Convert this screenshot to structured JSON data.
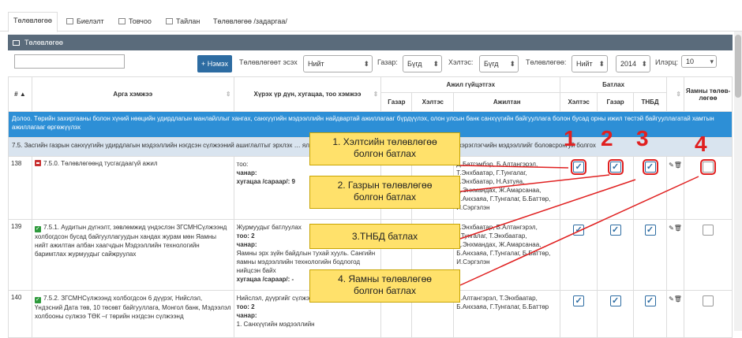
{
  "tabs": [
    {
      "label": "Төлөвлөгөө"
    },
    {
      "label": "Биелэлт"
    },
    {
      "label": "Товчоо"
    },
    {
      "label": "Тайлан"
    },
    {
      "label": "Төлөвлөгөө /задаргаа/"
    }
  ],
  "panel_title": "Төлөвлөгөө",
  "toolbar": {
    "add_label": "+ Нэмэх",
    "filter1_label": "Төлөвлөгөөт эсэх",
    "filter1_value": "Нийт",
    "filter2_label": "Газар:",
    "filter2_value": "Бүгд",
    "filter3_label": "Хэлтэс:",
    "filter3_value": "Бүгд",
    "filter4_label": "Төлөвлөгөө:",
    "filter4_value": "Нийт",
    "year_value": "2014",
    "filter5_label": "Илэрц:",
    "page_size": "10"
  },
  "headers": {
    "num": "#",
    "activity": "Арга хэмжээ",
    "result": "Хүрэх үр дүн, хугацаа, тоо хэмжээ",
    "work_perf": "Ажил гүйцэтгэх",
    "dept": "Газар",
    "unit": "Хэлтэс",
    "staff": "Ажилтан",
    "approve": "Батлах",
    "a_unit": "Хэлтэс",
    "a_dept": "Газар",
    "a_tnbd": "ТНБД",
    "ministry": "Яамны төлөв-лөгөө"
  },
  "group_row_1": "Долоо. Төрийн захиргааны болон хүний нөөцийн удирдлагын манлайллыг хангах, санхүүгийн мэдээллийн найдвартай ажиллагааг бүрдүүлэх, олон улсын банк санхүүгийн байгууллага болон бусад орны ижил төстэй байгууллагатай хамтын ажиллагааг өргөжүүлэх",
  "group_row_2": "7.5. Засгийн газрын санхүүгийн удирдлагын мэдээллийн нэгдсэн сүлжээний ашиглалтыг эрхлэх … ялгаагүйгээр санхүүгийн мэдээллийн сан бүрдүүлэх, хэрэглэгчийн мэдээллийг боловсронгуй болгох",
  "rows": [
    {
      "num": "138",
      "activity": "7.5.0. Төлөвлөгөөнд тусгагдаагүй ажил",
      "result_l1": "тоо:",
      "result_l2": "чанар:",
      "result_l3": "хугацаа /сараар/: 9",
      "staff": "Д.Батгэмбэр, Б.Алтангэрэл, Т.Энхбаатар, Г.Тунгалаг, Т.Энхбаатар, Н.Азтуяа, Д.Энхмандах, Ж.Амарсанаа, Б.Анхзаяа, Г.Тунгалаг, Б.Баттөр, И.Сэргэлэн"
    },
    {
      "num": "139",
      "activity": "7.5.1. Аудитын дүгнэлт, зөвлөмжид үндэслэн ЗГСМНСүлжээнд холбогдсон бусад байгууллагуудын хандах журам мөн Яамны нийт ажилтан албан хаагчдын Мэдээллийн технологийн баримтлах журмуудыг сайжруулах",
      "result_l1": "Журмуудыг батлуулах",
      "result_l2": "тоо: 2",
      "result_l3": "чанар:",
      "result_l4": "Яамны эрх зүйн байдлын тухай хууль. Сангийн яамны мэдээллийн технологийн бодлогод нийцсэн байх",
      "result_l5": "хугацаа /сараар/: -",
      "staff": "Т.Энхбаатар, Б.Алтангэрэл, Г.Тунгалаг, Т.Энхбаатар, Д.Энхмандах, Ж.Амарсанаа, Б.Анхзаяа, Г.Тунгалаг, Б.Баттөр, И.Сэргэлэн"
    },
    {
      "num": "140",
      "activity": "7.5.2. ЗГСМНСүлжээнд холбогдсон 6 дүүрэг, Нийслэл, Үндэсний Дата төв, 10 төсөвт байгууллага, Монгол банк, Мэдээлэл холбооны сүлжээ ТӨК –г төрийн нэгдсэн сүлжээнд",
      "result_l1": "Нийслэл, дүүргийг сүлжээнд",
      "result_l2": "тоо: 2",
      "result_l3": "чанар:",
      "result_l4": "1. Санхүүгийн мэдээллийн",
      "staff": "Б.Алтангэрэл, Т.Энхбаатар, Б.Анхзаяа, Г.Тунгалаг, Б.Баттөр"
    }
  ],
  "callouts": [
    {
      "num": "1",
      "text_l1": "1. Хэлтсийн төлөвлөгөө",
      "text_l2": "болгон батлах"
    },
    {
      "num": "2",
      "text_l1": "2. Газрын төлөвлөгөө",
      "text_l2": "болгон батлах"
    },
    {
      "num": "3",
      "text_l1": "3.ТНБД батлах",
      "text_l2": ""
    },
    {
      "num": "4",
      "text_l1": "4. Яамны төлөвлөгөө",
      "text_l2": "болгон батлах"
    }
  ],
  "colors": {
    "accent": "#2d6ca2",
    "group_row": "#2d8fd6",
    "callout": "#ffe16b",
    "marker": "#e02020"
  }
}
